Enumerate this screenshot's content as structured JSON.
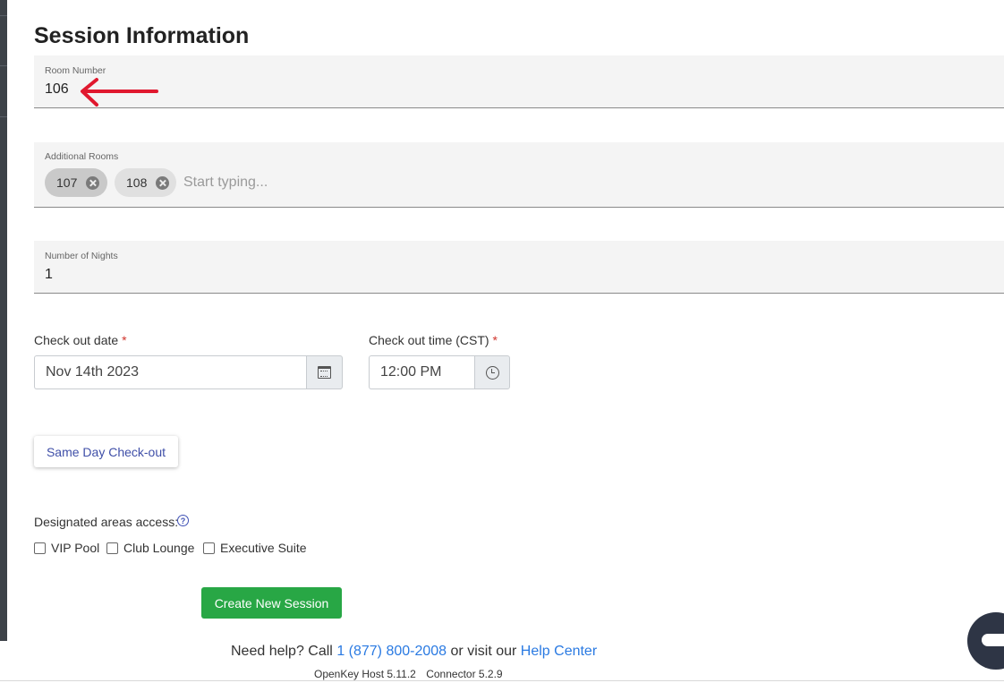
{
  "page": {
    "title": "Session Information"
  },
  "room_number": {
    "label": "Room Number",
    "value": "106"
  },
  "additional_rooms": {
    "label": "Additional Rooms",
    "chips": [
      "107",
      "108"
    ],
    "placeholder": "Start typing..."
  },
  "nights": {
    "label": "Number of Nights",
    "value": "1"
  },
  "checkout_date": {
    "label": "Check out date",
    "required_mark": "*",
    "value": "Nov 14th 2023",
    "icon": "calendar-icon"
  },
  "checkout_time": {
    "label": "Check out time (CST)",
    "required_mark": "*",
    "value": "12:00 PM",
    "icon": "clock-icon"
  },
  "same_day_button": "Same Day Check-out",
  "areas": {
    "label": "Designated areas access:",
    "help_glyph": "?",
    "options": [
      "VIP Pool",
      "Club Lounge",
      "Executive Suite"
    ]
  },
  "create_button": "Create New Session",
  "footer": {
    "help_prefix": "Need help? Call",
    "phone": "1 (877) 800-2008",
    "help_middle": "or visit our",
    "help_link": "Help Center",
    "host_version": "OpenKey Host 5.11.2",
    "connector_version": "Connector 5.2.9"
  },
  "colors": {
    "accent_green": "#28a745",
    "link_blue": "#2a7ae2",
    "annotation_red": "#e0182e",
    "button_text": "#3f4fa8"
  }
}
